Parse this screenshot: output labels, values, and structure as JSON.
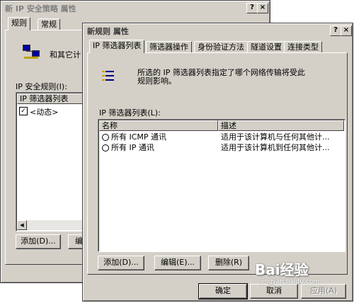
{
  "back_window": {
    "title": "新 IP 安全策略 属性",
    "tabs": [
      "规则",
      "常规"
    ],
    "description": "和其它计",
    "rules_label": "IP 安全规则(I):",
    "list_header": "IP 筛选器列表",
    "rule_item": "<动态>",
    "add_button": "添加(D)...",
    "edit_button": "编辑"
  },
  "front_window": {
    "title": "新规则 属性",
    "tabs": [
      "IP 筛选器列表",
      "筛选器操作",
      "身份验证方法",
      "隧道设置",
      "连接类型"
    ],
    "description": "所选的 IP 筛选器列表指定了哪个网络传输将受此规则影响。",
    "list_label": "IP 筛选器列表(L):",
    "columns": [
      "名称",
      "描述"
    ],
    "rows": [
      {
        "name": "所有 ICMP 通讯",
        "desc": "适用于该计算机与任何其他计..."
      },
      {
        "name": "所有 IP 通讯",
        "desc": "适用于该计算机到任何其他计..."
      }
    ],
    "add_button": "添加(D)...",
    "edit_button": "编辑(E)...",
    "delete_button": "删除(R)",
    "ok_button": "确定",
    "cancel_button": "取消",
    "apply_button": "应用(A)"
  },
  "title_buttons": {
    "help": "?",
    "close": "×"
  },
  "watermark": {
    "text": "Bai经验",
    "url": "jingyan.baidu.com"
  }
}
